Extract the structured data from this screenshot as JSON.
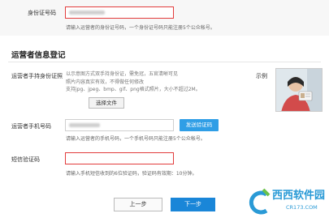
{
  "id_card": {
    "label": "身份证号码",
    "hint": "请输入运营者的身份证号码，一个身份证号码只能注册5个公众帐号。"
  },
  "section": {
    "title": "运营者信息登记"
  },
  "photo": {
    "label": "运营者手持身份证照",
    "desc_lines": [
      "以示意图方式双手持身份证，需免冠，五官清晰可见",
      "照片内容真实有效，不得做任何修改",
      "支持jpg、jpeg、bmp、gif、png格式照片，大小不超过2M。"
    ],
    "choose_button": "选择文件",
    "sample_label": "示例"
  },
  "phone": {
    "label": "运营者手机号码",
    "send_button": "发送验证码",
    "hint": "请输入运营者的手机号码，一个手机号码只能注册5个公众帐号。"
  },
  "sms": {
    "label": "短信验证码",
    "hint": "请输入手机短信收到的6位验证码，验证码有效期：10分钟。"
  },
  "nav": {
    "prev_button": "上一步",
    "next_button": "下一步"
  },
  "watermark": {
    "text": "西西软件园",
    "url": "CR173.COM"
  }
}
